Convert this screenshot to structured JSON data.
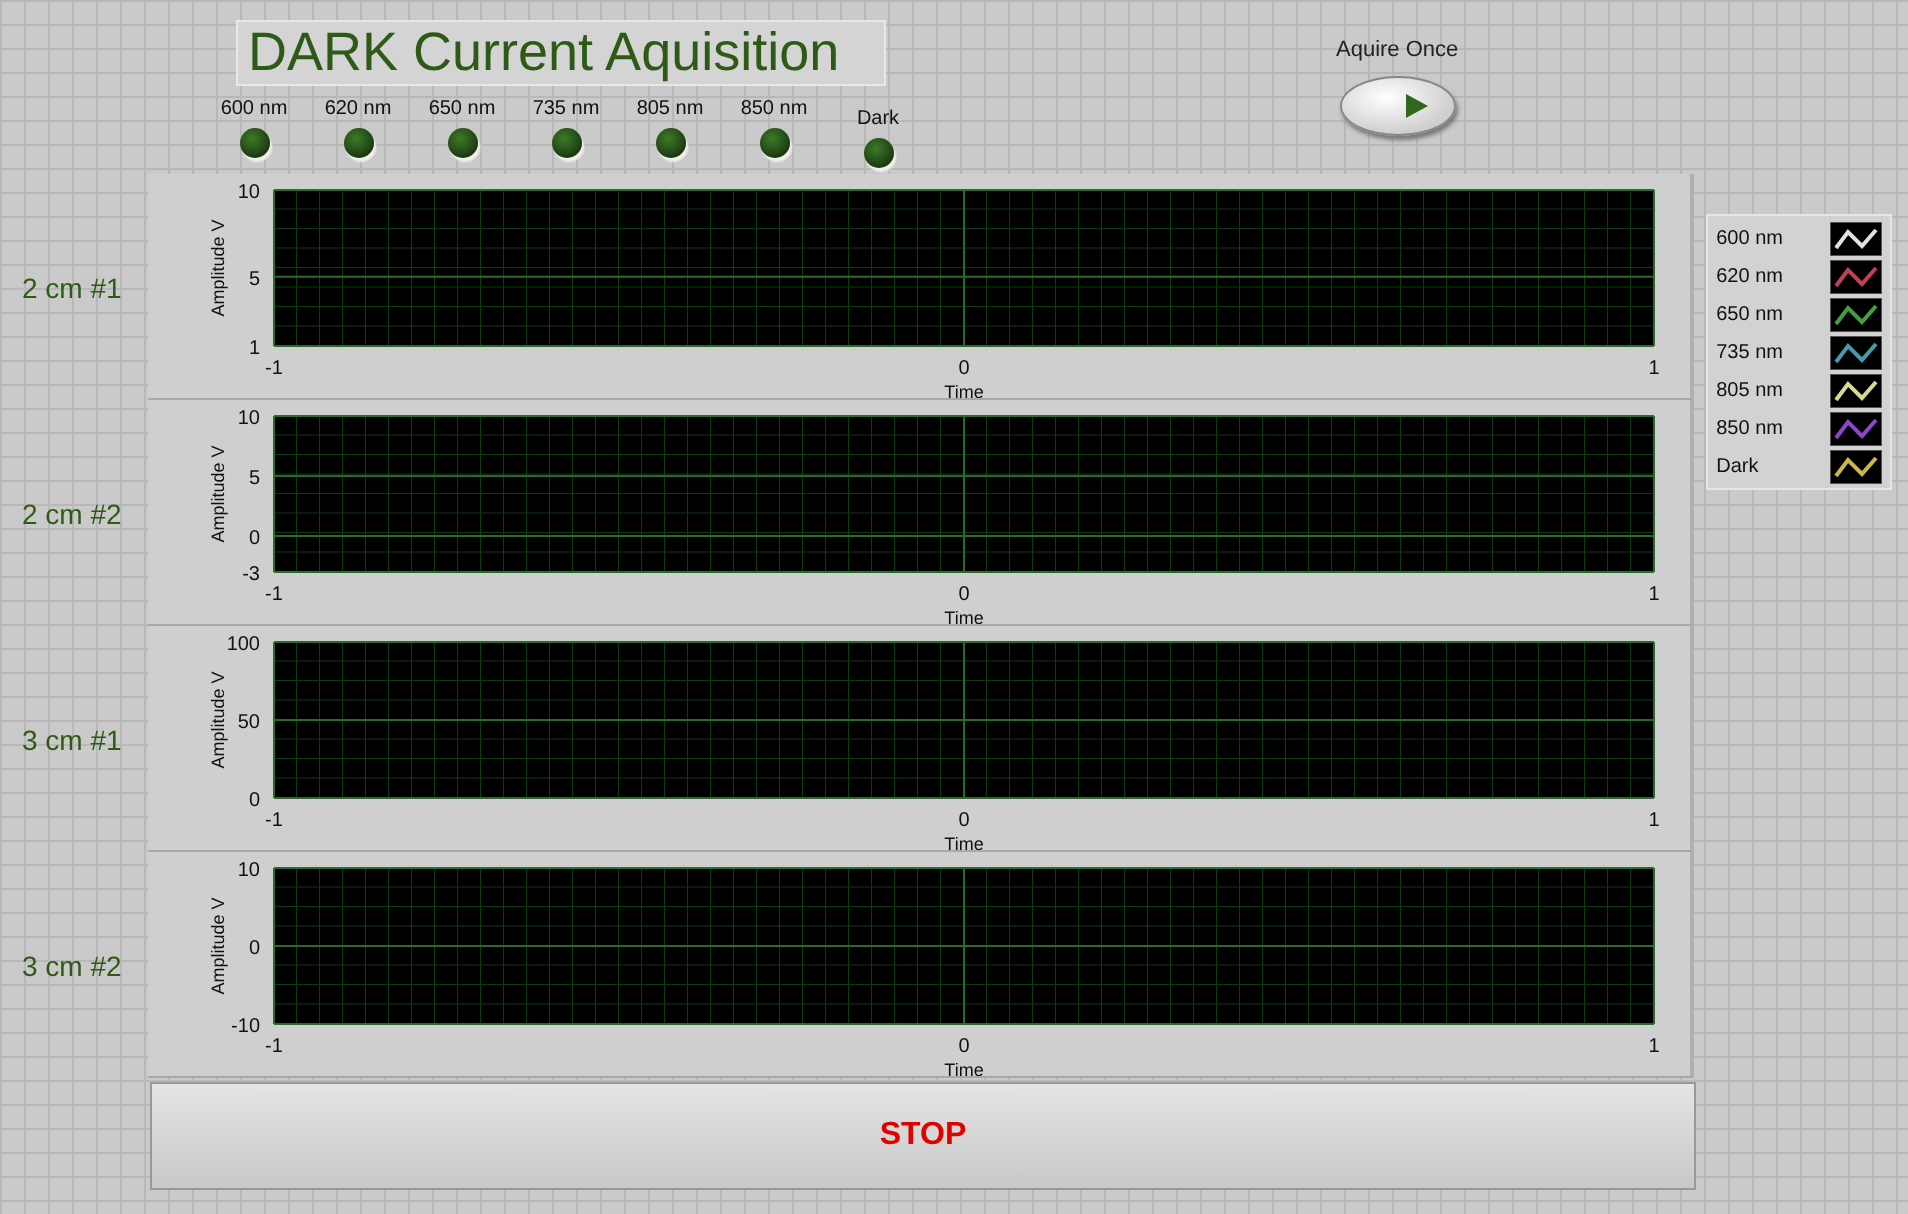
{
  "title": "DARK Current Aquisition",
  "leds": [
    {
      "label": "600 nm",
      "on": false
    },
    {
      "label": "620 nm",
      "on": false
    },
    {
      "label": "650 nm",
      "on": false
    },
    {
      "label": "735 nm",
      "on": false
    },
    {
      "label": "805 nm",
      "on": false
    },
    {
      "label": "850 nm",
      "on": false
    },
    {
      "label": "Dark",
      "on": false
    }
  ],
  "aquire_button": {
    "label": "Aquire Once",
    "on": false
  },
  "graphs": [
    {
      "label": "2 cm #1",
      "chart_data": {
        "type": "line",
        "xlabel": "Time",
        "ylabel": "Amplitude V",
        "xlim": [
          -1,
          1
        ],
        "ylim": [
          1,
          10
        ],
        "xticks": [
          -1,
          0,
          1
        ],
        "yticks": [
          1,
          5,
          10
        ],
        "grid": true
      }
    },
    {
      "label": "2 cm #2",
      "chart_data": {
        "type": "line",
        "xlabel": "Time",
        "ylabel": "Amplitude V",
        "xlim": [
          -1,
          1
        ],
        "ylim": [
          -3,
          10
        ],
        "xticks": [
          -1,
          0,
          1
        ],
        "yticks": [
          -3,
          0,
          5,
          10
        ],
        "grid": true
      }
    },
    {
      "label": "3 cm #1",
      "chart_data": {
        "type": "line",
        "xlabel": "Time",
        "ylabel": "Amplitude V",
        "xlim": [
          -1,
          1
        ],
        "ylim": [
          0,
          100
        ],
        "xticks": [
          -1,
          0,
          1
        ],
        "yticks": [
          0,
          50,
          100
        ],
        "grid": true
      }
    },
    {
      "label": "3 cm #2",
      "chart_data": {
        "type": "line",
        "xlabel": "Time",
        "ylabel": "Amplitude V",
        "xlim": [
          -1,
          1
        ],
        "ylim": [
          -10,
          10
        ],
        "xticks": [
          -1,
          0,
          1
        ],
        "yticks": [
          -10,
          0,
          10
        ],
        "grid": true
      }
    }
  ],
  "legend": [
    {
      "label": "600 nm",
      "color": "#e0e0e0"
    },
    {
      "label": "620 nm",
      "color": "#c04058"
    },
    {
      "label": "650 nm",
      "color": "#40a040"
    },
    {
      "label": "735 nm",
      "color": "#4a98a8"
    },
    {
      "label": "805 nm",
      "color": "#d8d890"
    },
    {
      "label": "850 nm",
      "color": "#8848c8"
    },
    {
      "label": "Dark",
      "color": "#c8b848"
    }
  ],
  "stop_button": {
    "label": "STOP"
  }
}
